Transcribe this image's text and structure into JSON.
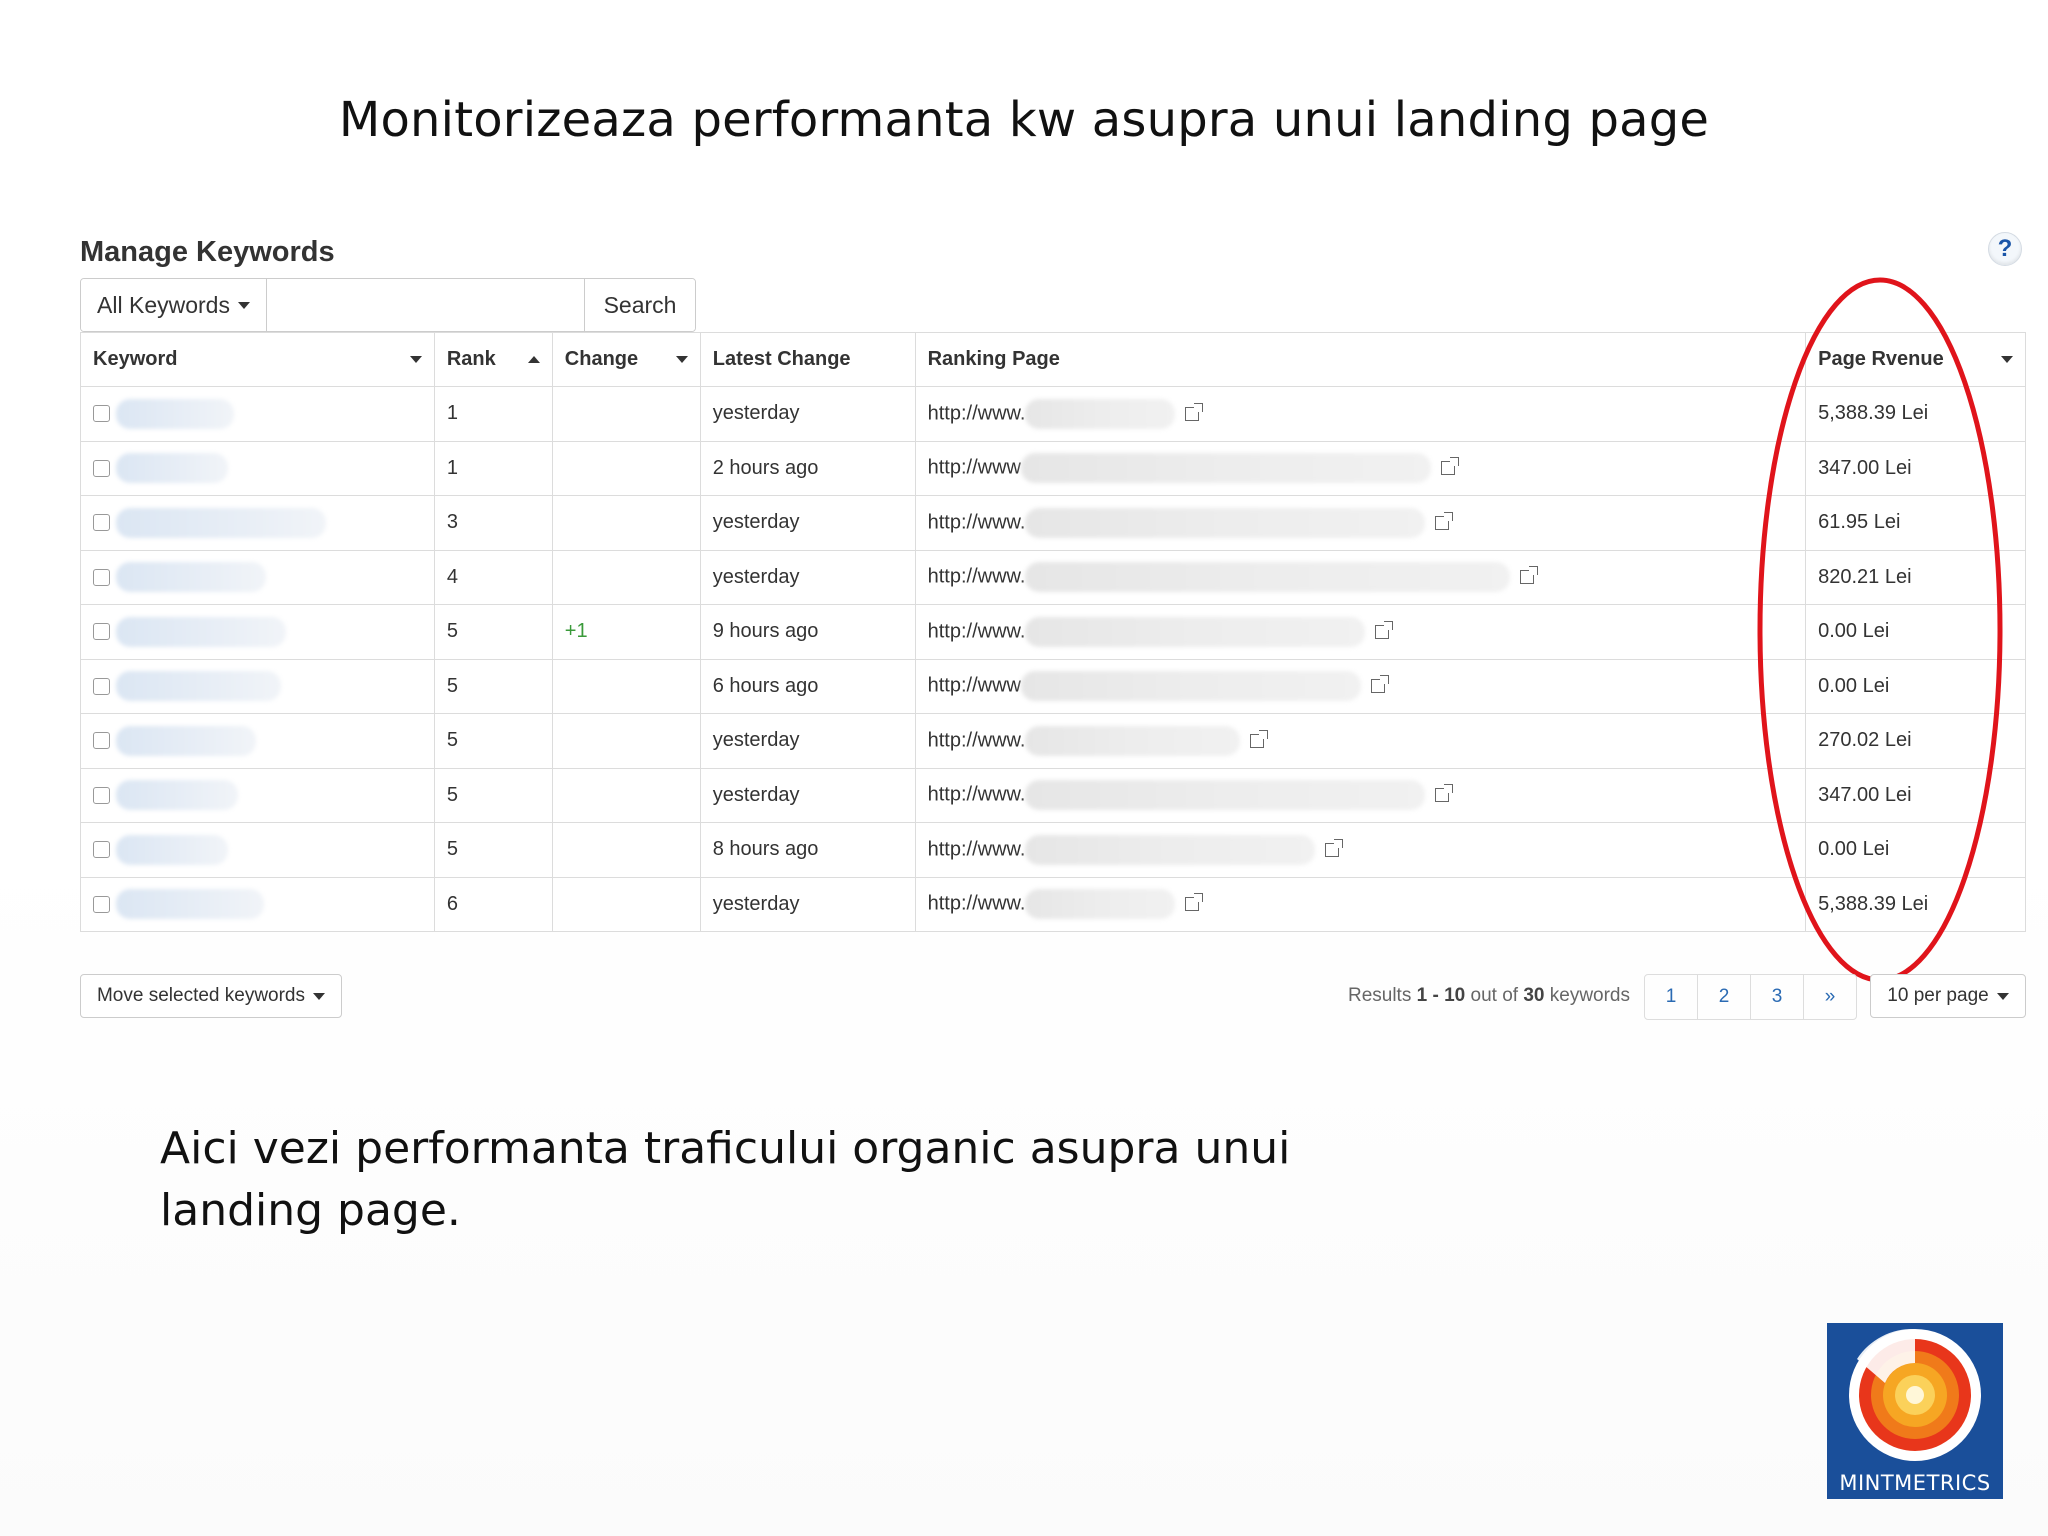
{
  "slide": {
    "title": "Monitorizeaza performanta kw asupra unui landing page",
    "caption": "Aici vezi performanta traficului organic asupra unui landing page."
  },
  "panel": {
    "title": "Manage Keywords",
    "help_icon": "?",
    "filter_label": "All Keywords",
    "search_value": "",
    "search_label": "Search"
  },
  "table": {
    "headers": {
      "keyword": "Keyword",
      "rank": "Rank",
      "change": "Change",
      "latest_change": "Latest Change",
      "ranking_page": "Ranking Page",
      "page_revenue": "Page Rvenue"
    },
    "rows": [
      {
        "rank": "1",
        "change": "",
        "latest": "yesterday",
        "url": "http://www.",
        "revenue": "5,388.39 Lei"
      },
      {
        "rank": "1",
        "change": "",
        "latest": "2 hours ago",
        "url": "http://www",
        "revenue": "347.00 Lei"
      },
      {
        "rank": "3",
        "change": "",
        "latest": "yesterday",
        "url": "http://www.",
        "revenue": "61.95 Lei"
      },
      {
        "rank": "4",
        "change": "",
        "latest": "yesterday",
        "url": "http://www.",
        "revenue": "820.21 Lei"
      },
      {
        "rank": "5",
        "change": "+1",
        "latest": "9 hours ago",
        "url": "http://www.",
        "revenue": "0.00 Lei"
      },
      {
        "rank": "5",
        "change": "",
        "latest": "6 hours ago",
        "url": "http://www",
        "revenue": "0.00 Lei"
      },
      {
        "rank": "5",
        "change": "",
        "latest": "yesterday",
        "url": "http://www.",
        "revenue": "270.02 Lei"
      },
      {
        "rank": "5",
        "change": "",
        "latest": "yesterday",
        "url": "http://www.",
        "revenue": "347.00 Lei"
      },
      {
        "rank": "5",
        "change": "",
        "latest": "8 hours ago",
        "url": "http://www.",
        "revenue": "0.00 Lei"
      },
      {
        "rank": "6",
        "change": "",
        "latest": "yesterday",
        "url": "http://www.",
        "revenue": "5,388.39 Lei"
      }
    ]
  },
  "footer": {
    "move_label": "Move selected keywords",
    "results_prefix": "Results",
    "results_from": "1",
    "results_dash": "-",
    "results_to": "10",
    "results_mid": "out of",
    "results_total": "30",
    "results_suffix": "keywords",
    "pages": [
      "1",
      "2",
      "3",
      "»"
    ],
    "per_page": "10 per page"
  },
  "logo": {
    "text": "MINTMETRICS"
  },
  "colors": {
    "annotation_ellipse": "#e0141b",
    "link": "#2a6ab3",
    "positive_change": "#3a9a3a",
    "logo_bg": "#1a4f9a"
  },
  "icons": [
    "help-icon",
    "caret-down-icon",
    "sort-up-icon",
    "external-link-icon",
    "checkbox-icon"
  ]
}
